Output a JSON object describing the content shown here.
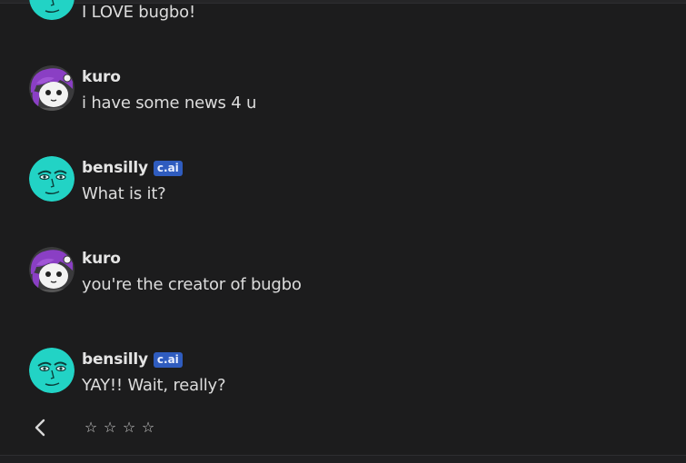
{
  "messages": [
    {
      "author": "",
      "badge": "",
      "text": "I LOVE bugbo!",
      "avatar": "bensilly-avatar"
    },
    {
      "author": "kuro",
      "badge": "",
      "text": "i have some news 4 u",
      "avatar": "kuro-avatar"
    },
    {
      "author": "bensilly",
      "badge": "c.ai",
      "text": "What is it?",
      "avatar": "bensilly-avatar"
    },
    {
      "author": "kuro",
      "badge": "",
      "text": "you're the creator of bugbo",
      "avatar": "kuro-avatar"
    },
    {
      "author": "bensilly",
      "badge": "c.ai",
      "text": "YAY!! Wait, really?",
      "avatar": "bensilly-avatar"
    }
  ],
  "controls": {
    "back_icon": "chevron-left-icon",
    "rating": {
      "value": 0,
      "max": 4,
      "star_glyph": "☆"
    }
  },
  "colors": {
    "background": "#1c1c1d",
    "badge": "#2f5cbf",
    "kuro_avatar": "#8a3fc4",
    "bensilly_avatar": "#22d3c5"
  }
}
